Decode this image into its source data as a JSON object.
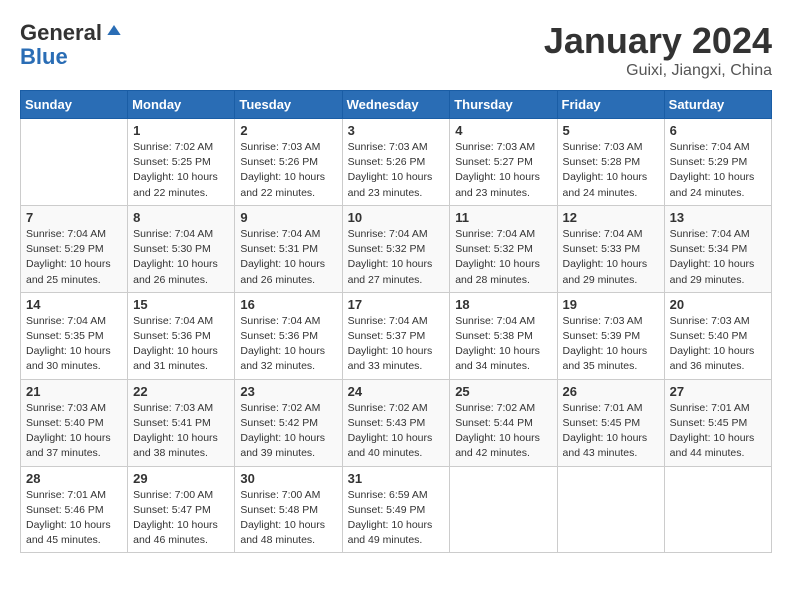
{
  "header": {
    "logo_line1": "General",
    "logo_line2": "Blue",
    "month_title": "January 2024",
    "location": "Guixi, Jiangxi, China"
  },
  "weekdays": [
    "Sunday",
    "Monday",
    "Tuesday",
    "Wednesday",
    "Thursday",
    "Friday",
    "Saturday"
  ],
  "weeks": [
    [
      {
        "day": "",
        "info": ""
      },
      {
        "day": "1",
        "info": "Sunrise: 7:02 AM\nSunset: 5:25 PM\nDaylight: 10 hours\nand 22 minutes."
      },
      {
        "day": "2",
        "info": "Sunrise: 7:03 AM\nSunset: 5:26 PM\nDaylight: 10 hours\nand 22 minutes."
      },
      {
        "day": "3",
        "info": "Sunrise: 7:03 AM\nSunset: 5:26 PM\nDaylight: 10 hours\nand 23 minutes."
      },
      {
        "day": "4",
        "info": "Sunrise: 7:03 AM\nSunset: 5:27 PM\nDaylight: 10 hours\nand 23 minutes."
      },
      {
        "day": "5",
        "info": "Sunrise: 7:03 AM\nSunset: 5:28 PM\nDaylight: 10 hours\nand 24 minutes."
      },
      {
        "day": "6",
        "info": "Sunrise: 7:04 AM\nSunset: 5:29 PM\nDaylight: 10 hours\nand 24 minutes."
      }
    ],
    [
      {
        "day": "7",
        "info": "Sunrise: 7:04 AM\nSunset: 5:29 PM\nDaylight: 10 hours\nand 25 minutes."
      },
      {
        "day": "8",
        "info": "Sunrise: 7:04 AM\nSunset: 5:30 PM\nDaylight: 10 hours\nand 26 minutes."
      },
      {
        "day": "9",
        "info": "Sunrise: 7:04 AM\nSunset: 5:31 PM\nDaylight: 10 hours\nand 26 minutes."
      },
      {
        "day": "10",
        "info": "Sunrise: 7:04 AM\nSunset: 5:32 PM\nDaylight: 10 hours\nand 27 minutes."
      },
      {
        "day": "11",
        "info": "Sunrise: 7:04 AM\nSunset: 5:32 PM\nDaylight: 10 hours\nand 28 minutes."
      },
      {
        "day": "12",
        "info": "Sunrise: 7:04 AM\nSunset: 5:33 PM\nDaylight: 10 hours\nand 29 minutes."
      },
      {
        "day": "13",
        "info": "Sunrise: 7:04 AM\nSunset: 5:34 PM\nDaylight: 10 hours\nand 29 minutes."
      }
    ],
    [
      {
        "day": "14",
        "info": "Sunrise: 7:04 AM\nSunset: 5:35 PM\nDaylight: 10 hours\nand 30 minutes."
      },
      {
        "day": "15",
        "info": "Sunrise: 7:04 AM\nSunset: 5:36 PM\nDaylight: 10 hours\nand 31 minutes."
      },
      {
        "day": "16",
        "info": "Sunrise: 7:04 AM\nSunset: 5:36 PM\nDaylight: 10 hours\nand 32 minutes."
      },
      {
        "day": "17",
        "info": "Sunrise: 7:04 AM\nSunset: 5:37 PM\nDaylight: 10 hours\nand 33 minutes."
      },
      {
        "day": "18",
        "info": "Sunrise: 7:04 AM\nSunset: 5:38 PM\nDaylight: 10 hours\nand 34 minutes."
      },
      {
        "day": "19",
        "info": "Sunrise: 7:03 AM\nSunset: 5:39 PM\nDaylight: 10 hours\nand 35 minutes."
      },
      {
        "day": "20",
        "info": "Sunrise: 7:03 AM\nSunset: 5:40 PM\nDaylight: 10 hours\nand 36 minutes."
      }
    ],
    [
      {
        "day": "21",
        "info": "Sunrise: 7:03 AM\nSunset: 5:40 PM\nDaylight: 10 hours\nand 37 minutes."
      },
      {
        "day": "22",
        "info": "Sunrise: 7:03 AM\nSunset: 5:41 PM\nDaylight: 10 hours\nand 38 minutes."
      },
      {
        "day": "23",
        "info": "Sunrise: 7:02 AM\nSunset: 5:42 PM\nDaylight: 10 hours\nand 39 minutes."
      },
      {
        "day": "24",
        "info": "Sunrise: 7:02 AM\nSunset: 5:43 PM\nDaylight: 10 hours\nand 40 minutes."
      },
      {
        "day": "25",
        "info": "Sunrise: 7:02 AM\nSunset: 5:44 PM\nDaylight: 10 hours\nand 42 minutes."
      },
      {
        "day": "26",
        "info": "Sunrise: 7:01 AM\nSunset: 5:45 PM\nDaylight: 10 hours\nand 43 minutes."
      },
      {
        "day": "27",
        "info": "Sunrise: 7:01 AM\nSunset: 5:45 PM\nDaylight: 10 hours\nand 44 minutes."
      }
    ],
    [
      {
        "day": "28",
        "info": "Sunrise: 7:01 AM\nSunset: 5:46 PM\nDaylight: 10 hours\nand 45 minutes."
      },
      {
        "day": "29",
        "info": "Sunrise: 7:00 AM\nSunset: 5:47 PM\nDaylight: 10 hours\nand 46 minutes."
      },
      {
        "day": "30",
        "info": "Sunrise: 7:00 AM\nSunset: 5:48 PM\nDaylight: 10 hours\nand 48 minutes."
      },
      {
        "day": "31",
        "info": "Sunrise: 6:59 AM\nSunset: 5:49 PM\nDaylight: 10 hours\nand 49 minutes."
      },
      {
        "day": "",
        "info": ""
      },
      {
        "day": "",
        "info": ""
      },
      {
        "day": "",
        "info": ""
      }
    ]
  ]
}
